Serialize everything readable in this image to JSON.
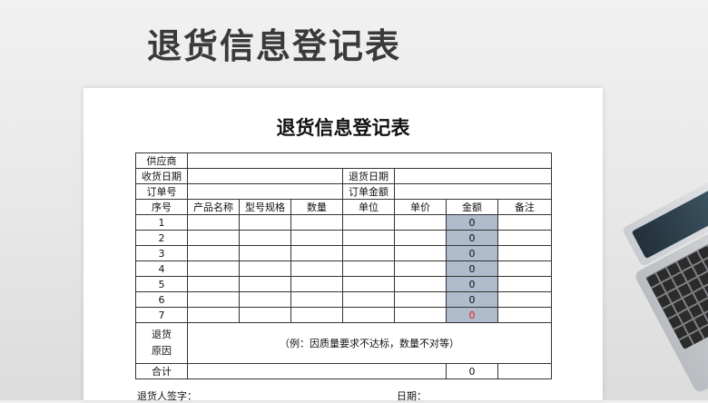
{
  "headline": "退货信息登记表",
  "document": {
    "title": "退货信息登记表",
    "supplier_label": "供应商",
    "receive_date_label": "收货日期",
    "return_date_label": "退货日期",
    "order_no_label": "订单号",
    "order_amount_label": "订单金额",
    "columns": [
      "序号",
      "产品名称",
      "型号规格",
      "数量",
      "单位",
      "单价",
      "金额",
      "备注"
    ],
    "rows": [
      {
        "no": "1",
        "amount": "0"
      },
      {
        "no": "2",
        "amount": "0"
      },
      {
        "no": "3",
        "amount": "0"
      },
      {
        "no": "4",
        "amount": "0"
      },
      {
        "no": "5",
        "amount": "0"
      },
      {
        "no": "6",
        "amount": "0"
      },
      {
        "no": "7",
        "amount": "0"
      }
    ],
    "reason_label_1": "退货",
    "reason_label_2": "原因",
    "reason_hint": "（例：因质量要求不达标，数量不对等）",
    "total_label": "合计",
    "total_value": "0",
    "signature_label": "退货人签字：",
    "date_label": "日期："
  },
  "colors": {
    "amount_fill": "#aebccc",
    "highlight_text": "#e02020"
  }
}
